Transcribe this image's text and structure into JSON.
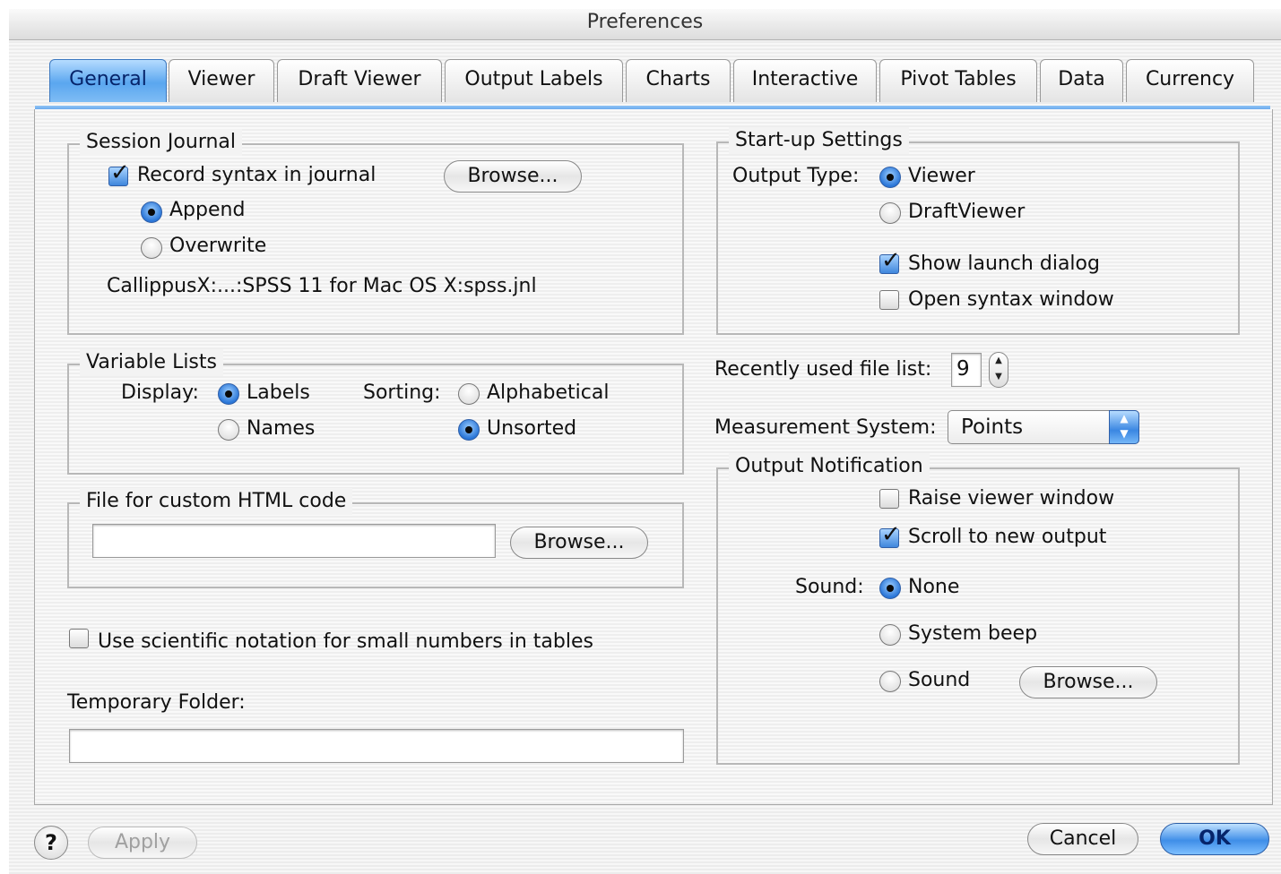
{
  "window": {
    "title": "Preferences"
  },
  "tabs": [
    "General",
    "Viewer",
    "Draft Viewer",
    "Output Labels",
    "Charts",
    "Interactive",
    "Pivot Tables",
    "Data",
    "Currency"
  ],
  "session_journal": {
    "legend": "Session Journal",
    "record_label": "Record syntax in journal",
    "browse_label": "Browse...",
    "append_label": "Append",
    "overwrite_label": "Overwrite",
    "path": "CallippusX:...:SPSS 11 for Mac OS X:spss.jnl"
  },
  "variable_lists": {
    "legend": "Variable Lists",
    "display_label": "Display:",
    "labels_label": "Labels",
    "names_label": "Names",
    "sorting_label": "Sorting:",
    "alphabetical_label": "Alphabetical",
    "unsorted_label": "Unsorted"
  },
  "custom_html": {
    "legend": "File for custom HTML code",
    "value": "",
    "browse_label": "Browse..."
  },
  "scientific_notation_label": "Use scientific notation for small numbers in tables",
  "temporary_folder": {
    "label": "Temporary Folder:",
    "value": ""
  },
  "startup": {
    "legend": "Start-up Settings",
    "output_type_label": "Output Type:",
    "viewer_label": "Viewer",
    "draftviewer_label": "DraftViewer",
    "show_launch_label": "Show launch dialog",
    "open_syntax_label": "Open syntax window"
  },
  "recent_files": {
    "label": "Recently used file list:",
    "value": "9"
  },
  "measurement": {
    "label": "Measurement System:",
    "value": "Points"
  },
  "notification": {
    "legend": "Output Notification",
    "raise_label": "Raise viewer window",
    "scroll_label": "Scroll to new output",
    "sound_label": "Sound:",
    "none_label": "None",
    "beep_label": "System beep",
    "sound_option_label": "Sound",
    "browse_label": "Browse..."
  },
  "footer": {
    "help_symbol": "?",
    "apply_label": "Apply",
    "cancel_label": "Cancel",
    "ok_label": "OK"
  },
  "colors": {
    "accent": "#3f8ee8",
    "tab_active": "#5aa6ef"
  },
  "icons": {
    "help": "help-icon",
    "check": "check-mark-icon",
    "stepper": "stepper-arrows-icon",
    "popup": "popup-arrows-icon"
  }
}
